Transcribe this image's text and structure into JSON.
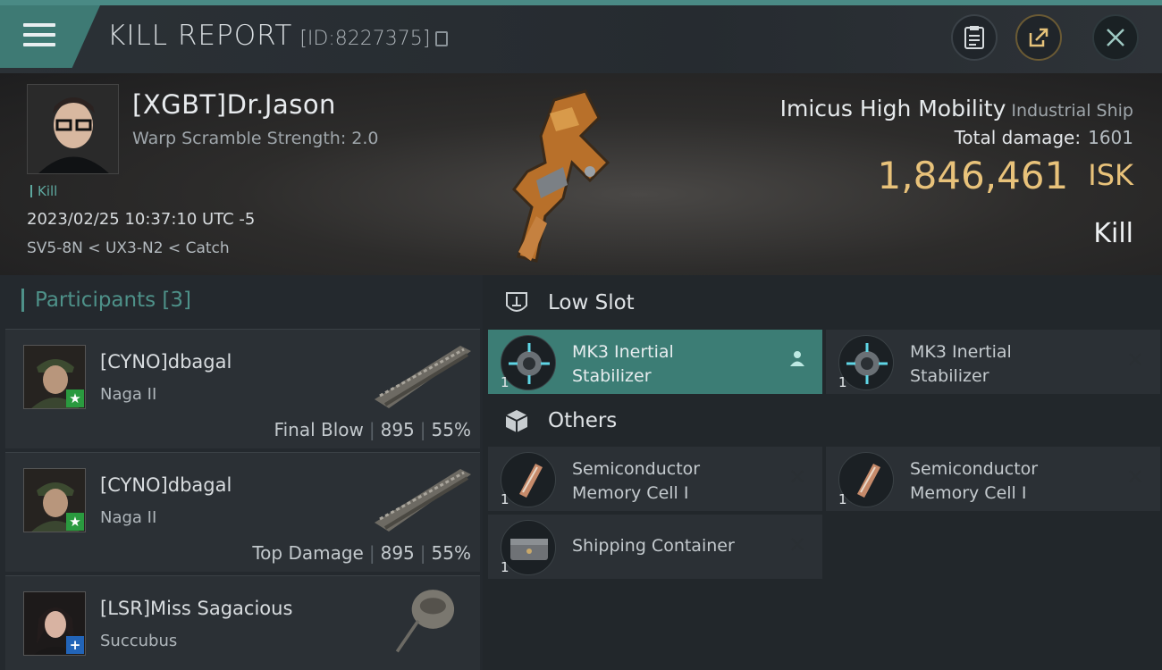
{
  "header": {
    "title": "KILL REPORT",
    "report_id": "[ID:8227375]",
    "icons": {
      "menu": "menu-icon",
      "copy": "copy-icon",
      "clipboard": "clipboard-icon",
      "share": "share-icon",
      "close": "close-icon"
    }
  },
  "victim": {
    "name": "[XGBT]Dr.Jason",
    "warp_scramble": "Warp Scramble Strength: 2.0",
    "tag": "Kill",
    "date": "2023/02/25 10:37:10 UTC -5",
    "location": "SV5-8N < UX3-N2 < Catch",
    "ship_name": "Imicus High Mobility",
    "ship_class": "Industrial Ship",
    "total_damage_label": "Total damage:",
    "total_damage": "1601",
    "isk_value": "1,846,461",
    "isk_unit": "ISK",
    "result": "Kill"
  },
  "participants": {
    "heading": "Participants [3]",
    "items": [
      {
        "name": "[CYNO]dbagal",
        "ship": "Naga II",
        "role": "Final Blow",
        "damage": "895",
        "percent": "55%",
        "badge": "★",
        "badge_color": "#2a9a3f"
      },
      {
        "name": "[CYNO]dbagal",
        "ship": "Naga II",
        "role": "Top Damage",
        "damage": "895",
        "percent": "55%",
        "badge": "★",
        "badge_color": "#2a9a3f"
      },
      {
        "name": "[LSR]Miss Sagacious",
        "ship": "Succubus",
        "role": "",
        "damage": "",
        "percent": "",
        "badge": "+",
        "badge_color": "#2264b8"
      }
    ]
  },
  "sections": {
    "low_slot": {
      "title": "Low Slot",
      "items": [
        {
          "line1": "MK3 Inertial",
          "line2": "Stabilizer",
          "qty": "1",
          "status": "pilot-icon",
          "active": true
        },
        {
          "line1": "MK3 Inertial",
          "line2": "Stabilizer",
          "qty": "1",
          "status": "destroyed-icon",
          "active": false
        }
      ]
    },
    "others": {
      "title": "Others",
      "items": [
        {
          "line1": "Semiconductor",
          "line2": "Memory Cell I",
          "qty": "1",
          "status": "destroyed-icon"
        },
        {
          "line1": "Semiconductor",
          "line2": "Memory Cell I",
          "qty": "1",
          "status": "destroyed-icon"
        },
        {
          "line1": "Shipping Container",
          "line2": "",
          "qty": "1",
          "status": "destroyed-icon"
        }
      ]
    }
  }
}
